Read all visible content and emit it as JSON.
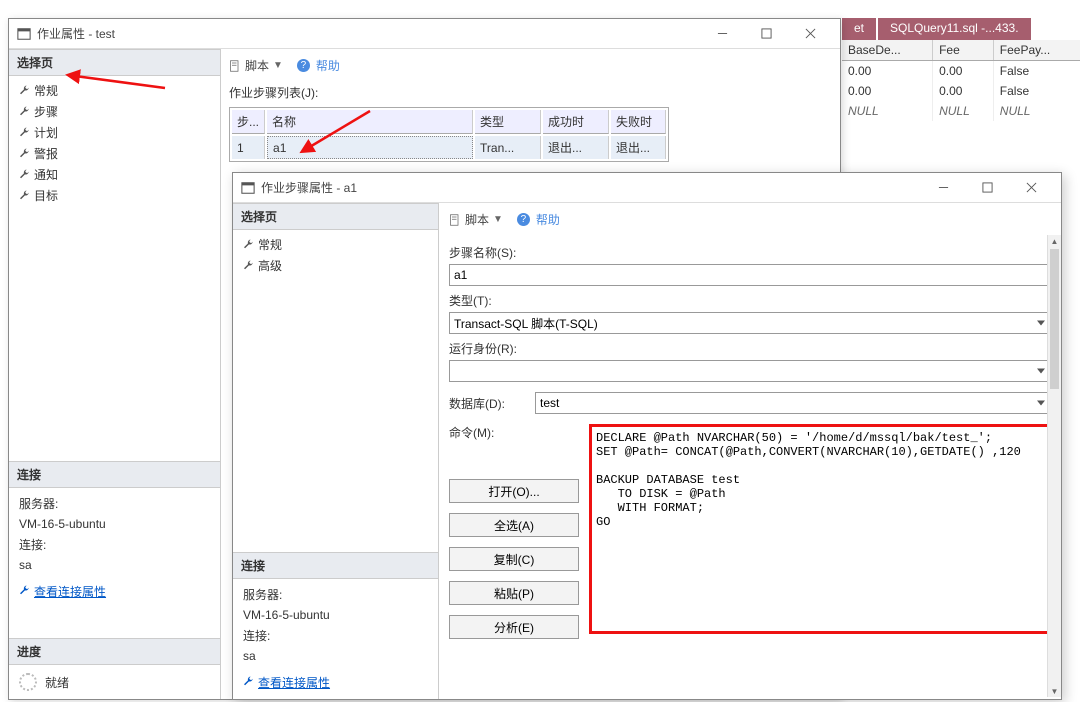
{
  "bg": {
    "tab1": "et",
    "tab2": "SQLQuery11.sql -...433.",
    "headers": [
      "BaseDe...",
      "Fee",
      "FeePay..."
    ],
    "rows": [
      [
        "0.00",
        "0.00",
        "False"
      ],
      [
        "0.00",
        "0.00",
        "False"
      ],
      [
        "NULL",
        "NULL",
        "NULL"
      ]
    ]
  },
  "win1": {
    "title": "作业属性 - test",
    "side_header": "选择页",
    "side_items": [
      "常规",
      "步骤",
      "计划",
      "警报",
      "通知",
      "目标"
    ],
    "conn_header": "连接",
    "server_label": "服务器:",
    "server_value": "VM-16-5-ubuntu",
    "conn_label": "连接:",
    "conn_value": "sa",
    "view_conn": "查看连接属性",
    "progress_header": "进度",
    "ready": "就绪",
    "toolbar_script": "脚本",
    "toolbar_help": "帮助",
    "section": "作业步骤列表(J):",
    "grid_headers": [
      "步...",
      "名称",
      "类型",
      "成功时",
      "失败时"
    ],
    "grid_row": [
      "1",
      "a1",
      "Tran...",
      "退出...",
      "退出..."
    ]
  },
  "win2": {
    "title": "作业步骤属性 - a1",
    "side_header": "选择页",
    "side_items": [
      "常规",
      "高级"
    ],
    "conn_header": "连接",
    "server_label": "服务器:",
    "server_value": "VM-16-5-ubuntu",
    "conn_label": "连接:",
    "conn_value": "sa",
    "view_conn": "查看连接属性",
    "toolbar_script": "脚本",
    "toolbar_help": "帮助",
    "step_name_lbl": "步骤名称(S):",
    "step_name_val": "a1",
    "type_lbl": "类型(T):",
    "type_val": "Transact-SQL 脚本(T-SQL)",
    "runas_lbl": "运行身份(R):",
    "runas_val": "",
    "db_lbl": "数据库(D):",
    "db_val": "test",
    "cmd_lbl": "命令(M):",
    "btn_open": "打开(O)...",
    "btn_selectall": "全选(A)",
    "btn_copy": "复制(C)",
    "btn_paste": "粘贴(P)",
    "btn_parse": "分析(E)",
    "code": "DECLARE @Path NVARCHAR(50) = '/home/d/mssql/bak/test_';\nSET @Path= CONCAT(@Path,CONVERT(NVARCHAR(10),GETDATE() ,120\n\nBACKUP DATABASE test\n   TO DISK = @Path\n   WITH FORMAT;\nGO"
  }
}
